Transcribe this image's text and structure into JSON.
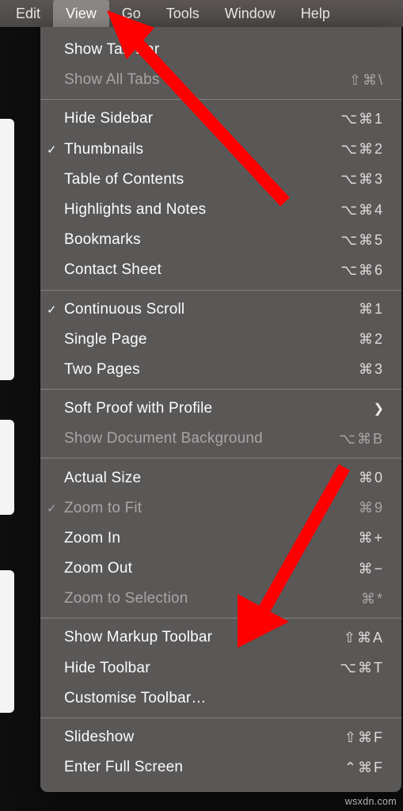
{
  "menubar": {
    "items": [
      "Edit",
      "View",
      "Go",
      "Tools",
      "Window",
      "Help"
    ],
    "active": "View"
  },
  "menu": {
    "groups": [
      [
        {
          "label": "Show Tab Bar",
          "shortcut": "",
          "checked": false,
          "enabled": true,
          "chev": false
        },
        {
          "label": "Show All Tabs",
          "shortcut": "⇧⌘\\",
          "checked": false,
          "enabled": false,
          "chev": false
        }
      ],
      [
        {
          "label": "Hide Sidebar",
          "shortcut": "⌥⌘1",
          "checked": false,
          "enabled": true,
          "chev": false
        },
        {
          "label": "Thumbnails",
          "shortcut": "⌥⌘2",
          "checked": true,
          "enabled": true,
          "chev": false
        },
        {
          "label": "Table of Contents",
          "shortcut": "⌥⌘3",
          "checked": false,
          "enabled": true,
          "chev": false
        },
        {
          "label": "Highlights and Notes",
          "shortcut": "⌥⌘4",
          "checked": false,
          "enabled": true,
          "chev": false
        },
        {
          "label": "Bookmarks",
          "shortcut": "⌥⌘5",
          "checked": false,
          "enabled": true,
          "chev": false
        },
        {
          "label": "Contact Sheet",
          "shortcut": "⌥⌘6",
          "checked": false,
          "enabled": true,
          "chev": false
        }
      ],
      [
        {
          "label": "Continuous Scroll",
          "shortcut": "⌘1",
          "checked": true,
          "enabled": true,
          "chev": false
        },
        {
          "label": "Single Page",
          "shortcut": "⌘2",
          "checked": false,
          "enabled": true,
          "chev": false
        },
        {
          "label": "Two Pages",
          "shortcut": "⌘3",
          "checked": false,
          "enabled": true,
          "chev": false
        }
      ],
      [
        {
          "label": "Soft Proof with Profile",
          "shortcut": "",
          "checked": false,
          "enabled": true,
          "chev": true
        },
        {
          "label": "Show Document Background",
          "shortcut": "⌥⌘B",
          "checked": false,
          "enabled": false,
          "chev": false
        }
      ],
      [
        {
          "label": "Actual Size",
          "shortcut": "⌘0",
          "checked": false,
          "enabled": true,
          "chev": false
        },
        {
          "label": "Zoom to Fit",
          "shortcut": "⌘9",
          "checked": true,
          "enabled": false,
          "chev": false
        },
        {
          "label": "Zoom In",
          "shortcut": "⌘+",
          "checked": false,
          "enabled": true,
          "chev": false
        },
        {
          "label": "Zoom Out",
          "shortcut": "⌘−",
          "checked": false,
          "enabled": true,
          "chev": false
        },
        {
          "label": "Zoom to Selection",
          "shortcut": "⌘*",
          "checked": false,
          "enabled": false,
          "chev": false
        }
      ],
      [
        {
          "label": "Show Markup Toolbar",
          "shortcut": "⇧⌘A",
          "checked": false,
          "enabled": true,
          "chev": false
        },
        {
          "label": "Hide Toolbar",
          "shortcut": "⌥⌘T",
          "checked": false,
          "enabled": true,
          "chev": false
        },
        {
          "label": "Customise Toolbar…",
          "shortcut": "",
          "checked": false,
          "enabled": true,
          "chev": false
        }
      ],
      [
        {
          "label": "Slideshow",
          "shortcut": "⇧⌘F",
          "checked": false,
          "enabled": true,
          "chev": false
        },
        {
          "label": "Enter Full Screen",
          "shortcut": "⌃⌘F",
          "checked": false,
          "enabled": true,
          "chev": false
        }
      ]
    ]
  },
  "watermark": "wsxdn.com"
}
